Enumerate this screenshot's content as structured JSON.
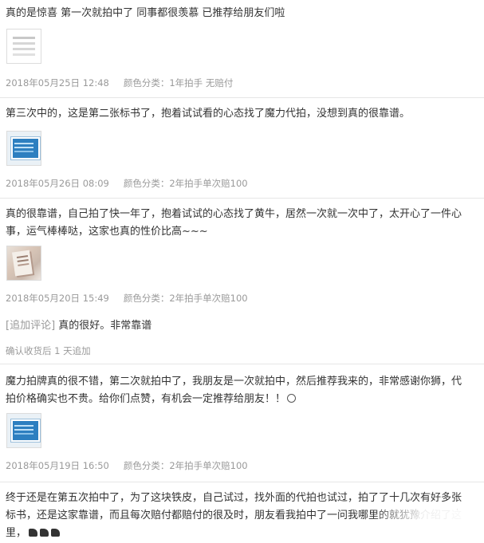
{
  "reviews": [
    {
      "text": "真的是惊喜 第一次就拍中了 同事都很羡慕 已推荐给朋友们啦",
      "date": "2018年05月25日 12:48",
      "category_label": "颜色分类：",
      "category": "1年拍手 无赔付",
      "thumb": "document-image"
    },
    {
      "text": "第三次中的，这是第二张标书了，抱着试试看的心态找了魔力代拍，没想到真的很靠谱。",
      "date": "2018年05月26日 08:09",
      "category_label": "颜色分类：",
      "category": "2年拍手单次赔100",
      "thumb": "screenshot-image"
    },
    {
      "text": "真的很靠谱，自己拍了快一年了，抱着试试的心态找了黄牛，居然一次就一次中了，太开心了一件心事，运气棒棒哒，这家也真的性价比高~~~",
      "date": "2018年05月20日 15:49",
      "category_label": "颜色分类：",
      "category": "2年拍手单次赔100",
      "thumb": "photo-image",
      "addon_tag": "[追加评论]",
      "addon_text": "真的很好。非常靠谱",
      "addon_meta": "确认收货后 1 天追加"
    },
    {
      "text": "魔力拍牌真的很不错，第二次就拍中了，我朋友是一次就拍中，然后推荐我来的，非常感谢你狮，代拍价格确实也不贵。给你们点赞，有机会一定推荐给朋友！！",
      "date": "2018年05月19日 16:50",
      "category_label": "颜色分类：",
      "category": "2年拍手单次赔100",
      "thumb": "screenshot-image"
    },
    {
      "text": "终于还是在第五次拍中了，为了这块铁皮，自己试过，找外面的代拍也试过，拍了了十几次有好多张标书，还是这家靠谱，而且每次赔付都赔付的很及时，朋友看我拍中了一问我哪里的就犹豫介绍了这里，"
    }
  ]
}
